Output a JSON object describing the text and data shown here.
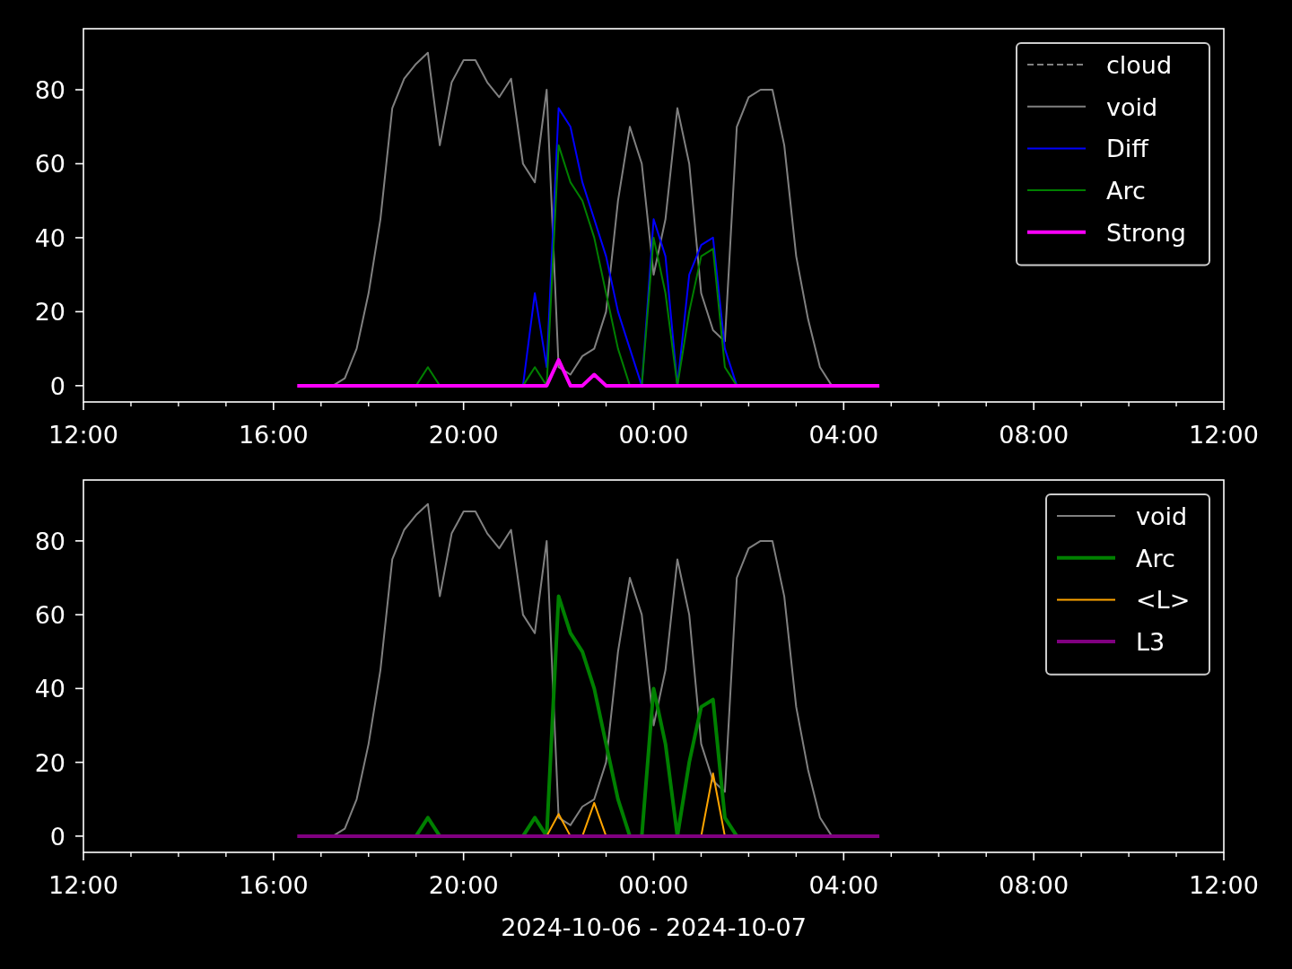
{
  "charts": [
    {
      "chart_data": {
        "type": "line",
        "categories": [
          "12:00",
          null,
          null,
          null,
          null,
          null,
          null,
          null,
          null,
          null,
          null,
          null,
          null,
          null,
          null,
          null,
          "16:00",
          null,
          null,
          null,
          null,
          null,
          null,
          null,
          null,
          null,
          null,
          null,
          null,
          null,
          null,
          null,
          "20:00",
          null,
          null,
          null,
          null,
          null,
          null,
          null,
          null,
          null,
          null,
          null,
          null,
          null,
          null,
          null,
          "00:00",
          null,
          null,
          null,
          null,
          null,
          null,
          null,
          null,
          null,
          null,
          null,
          null,
          null,
          null,
          null,
          "04:00",
          null,
          null,
          null,
          null,
          null,
          null,
          null,
          null,
          null,
          null,
          null,
          null,
          null,
          null,
          null,
          "08:00",
          null,
          null,
          null,
          null,
          null,
          null,
          null,
          null,
          null,
          null,
          null,
          null,
          null,
          null,
          null,
          "12:00"
        ],
        "ylim": [
          -4.4,
          96.5
        ],
        "yticks": [
          0,
          20,
          40,
          60,
          80
        ],
        "legend": true,
        "series": [
          {
            "name": "cloud",
            "color": "#808080",
            "line_style": "dashed",
            "values": [
              null,
              null,
              null,
              null,
              null,
              null,
              null,
              null,
              null,
              null,
              null,
              null,
              null,
              null,
              null,
              null,
              null,
              null,
              null,
              null,
              null,
              null,
              null,
              null,
              null,
              null,
              null,
              null,
              null,
              null,
              null,
              null,
              null,
              null,
              null,
              null,
              null,
              null,
              null,
              null,
              null,
              null,
              null,
              null,
              null,
              null,
              null,
              null,
              null,
              null,
              null,
              null,
              null,
              null,
              null,
              null,
              null,
              null,
              null,
              null,
              null,
              null,
              null,
              null,
              null,
              null,
              null,
              null,
              null,
              null,
              null,
              null,
              null,
              null,
              null,
              null,
              null,
              null,
              null,
              null,
              null,
              null,
              null,
              null,
              null,
              null,
              null,
              null,
              null,
              null,
              null,
              null,
              null,
              null,
              null,
              null,
              null
            ]
          },
          {
            "name": "void",
            "color": "#808080",
            "line_style": "solid",
            "values": [
              null,
              null,
              null,
              null,
              null,
              null,
              null,
              null,
              null,
              null,
              null,
              null,
              null,
              null,
              null,
              null,
              null,
              null,
              null,
              null,
              null,
              0,
              2,
              10,
              25,
              45,
              75,
              83,
              87,
              90,
              65,
              82,
              88,
              88,
              82,
              78,
              83,
              60,
              55,
              80,
              5,
              3,
              8,
              10,
              20,
              50,
              70,
              60,
              30,
              45,
              75,
              60,
              25,
              15,
              12,
              70,
              78,
              80,
              80,
              65,
              35,
              18,
              5,
              0,
              null,
              null,
              null,
              null,
              null,
              null,
              null,
              null,
              null,
              null,
              null,
              null,
              null,
              null,
              null,
              null,
              null,
              null,
              null,
              null,
              null,
              null,
              null,
              null,
              null,
              null,
              null,
              null,
              null,
              null,
              null,
              null,
              null
            ]
          },
          {
            "name": "Diff",
            "color": "#0000ff",
            "line_style": "solid",
            "values": [
              null,
              null,
              null,
              null,
              null,
              null,
              null,
              null,
              null,
              null,
              null,
              null,
              null,
              null,
              null,
              null,
              null,
              null,
              null,
              null,
              null,
              null,
              null,
              null,
              null,
              null,
              null,
              null,
              null,
              null,
              null,
              null,
              null,
              null,
              null,
              null,
              null,
              0,
              25,
              5,
              75,
              70,
              55,
              45,
              35,
              20,
              10,
              0,
              45,
              35,
              0,
              30,
              38,
              40,
              10,
              0,
              null,
              null,
              null,
              null,
              null,
              null,
              null,
              null,
              null,
              null,
              null,
              null,
              null,
              null,
              null,
              null,
              null,
              null,
              null,
              null,
              null,
              null,
              null,
              null,
              null,
              null,
              null,
              null,
              null,
              null,
              null,
              null,
              null,
              null,
              null,
              null,
              null,
              null,
              null,
              null,
              null
            ]
          },
          {
            "name": "Arc",
            "color": "#008000",
            "line_style": "solid",
            "values": [
              null,
              null,
              null,
              null,
              null,
              null,
              null,
              null,
              null,
              null,
              null,
              null,
              null,
              null,
              null,
              null,
              null,
              null,
              null,
              null,
              null,
              null,
              null,
              null,
              null,
              null,
              null,
              null,
              0,
              5,
              0,
              null,
              null,
              null,
              null,
              null,
              null,
              0,
              5,
              0,
              65,
              55,
              50,
              40,
              25,
              10,
              0,
              0,
              40,
              25,
              0,
              20,
              35,
              37,
              5,
              0,
              null,
              null,
              null,
              null,
              null,
              null,
              null,
              null,
              null,
              null,
              null,
              null,
              null,
              null,
              null,
              null,
              null,
              null,
              null,
              null,
              null,
              null,
              null,
              null,
              null,
              null,
              null,
              null,
              null,
              null,
              null,
              null,
              null,
              null,
              null,
              null,
              null,
              null,
              null,
              null,
              null
            ]
          },
          {
            "name": "Strong",
            "color": "#ff00ff",
            "line_style": "solid",
            "values": [
              null,
              null,
              null,
              null,
              null,
              null,
              null,
              null,
              null,
              null,
              null,
              null,
              null,
              null,
              null,
              null,
              null,
              null,
              0,
              0,
              0,
              0,
              0,
              0,
              0,
              0,
              0,
              0,
              0,
              0,
              0,
              0,
              0,
              0,
              0,
              0,
              0,
              0,
              0,
              0,
              7,
              0,
              0,
              3,
              0,
              0,
              0,
              0,
              0,
              0,
              0,
              0,
              0,
              0,
              0,
              0,
              0,
              0,
              0,
              0,
              0,
              0,
              0,
              0,
              0,
              0,
              0,
              0,
              null,
              null,
              null,
              null,
              null,
              null,
              null,
              null,
              null,
              null,
              null,
              null,
              null,
              null,
              null,
              null,
              null,
              null,
              null,
              null,
              null,
              null,
              null,
              null,
              null,
              null,
              null,
              null,
              null
            ]
          }
        ]
      }
    },
    {
      "chart_data": {
        "type": "line",
        "xlabel": "2024-10-06 - 2024-10-07",
        "categories": [
          "12:00",
          null,
          null,
          null,
          null,
          null,
          null,
          null,
          null,
          null,
          null,
          null,
          null,
          null,
          null,
          null,
          "16:00",
          null,
          null,
          null,
          null,
          null,
          null,
          null,
          null,
          null,
          null,
          null,
          null,
          null,
          null,
          null,
          "20:00",
          null,
          null,
          null,
          null,
          null,
          null,
          null,
          null,
          null,
          null,
          null,
          null,
          null,
          null,
          null,
          "00:00",
          null,
          null,
          null,
          null,
          null,
          null,
          null,
          null,
          null,
          null,
          null,
          null,
          null,
          null,
          null,
          "04:00",
          null,
          null,
          null,
          null,
          null,
          null,
          null,
          null,
          null,
          null,
          null,
          null,
          null,
          null,
          null,
          "08:00",
          null,
          null,
          null,
          null,
          null,
          null,
          null,
          null,
          null,
          null,
          null,
          null,
          null,
          null,
          null,
          "12:00"
        ],
        "ylim": [
          -4.4,
          96.5
        ],
        "yticks": [
          0,
          20,
          40,
          60,
          80
        ],
        "legend": true,
        "series": [
          {
            "name": "void",
            "color": "#808080",
            "line_style": "solid",
            "values": [
              null,
              null,
              null,
              null,
              null,
              null,
              null,
              null,
              null,
              null,
              null,
              null,
              null,
              null,
              null,
              null,
              null,
              null,
              null,
              null,
              null,
              0,
              2,
              10,
              25,
              45,
              75,
              83,
              87,
              90,
              65,
              82,
              88,
              88,
              82,
              78,
              83,
              60,
              55,
              80,
              5,
              3,
              8,
              10,
              20,
              50,
              70,
              60,
              30,
              45,
              75,
              60,
              25,
              15,
              12,
              70,
              78,
              80,
              80,
              65,
              35,
              18,
              5,
              0,
              null,
              null,
              null,
              null,
              null,
              null,
              null,
              null,
              null,
              null,
              null,
              null,
              null,
              null,
              null,
              null,
              null,
              null,
              null,
              null,
              null,
              null,
              null,
              null,
              null,
              null,
              null,
              null,
              null,
              null,
              null,
              null,
              null
            ]
          },
          {
            "name": "Arc",
            "color": "#008000",
            "line_style": "solid",
            "values": [
              null,
              null,
              null,
              null,
              null,
              null,
              null,
              null,
              null,
              null,
              null,
              null,
              null,
              null,
              null,
              null,
              null,
              null,
              null,
              null,
              null,
              null,
              null,
              null,
              null,
              null,
              null,
              null,
              0,
              5,
              0,
              null,
              null,
              null,
              null,
              null,
              null,
              0,
              5,
              0,
              65,
              55,
              50,
              40,
              25,
              10,
              0,
              0,
              40,
              25,
              0,
              20,
              35,
              37,
              5,
              0,
              null,
              null,
              null,
              null,
              null,
              null,
              null,
              null,
              null,
              null,
              null,
              null,
              null,
              null,
              null,
              null,
              null,
              null,
              null,
              null,
              null,
              null,
              null,
              null,
              null,
              null,
              null,
              null,
              null,
              null,
              null,
              null,
              null,
              null,
              null,
              null,
              null,
              null,
              null,
              null,
              null
            ]
          },
          {
            "name": "<L>",
            "color": "#ffa500",
            "line_style": "solid",
            "values": [
              null,
              null,
              null,
              null,
              null,
              null,
              null,
              null,
              null,
              null,
              null,
              null,
              null,
              null,
              null,
              null,
              null,
              null,
              null,
              null,
              null,
              null,
              null,
              null,
              null,
              null,
              null,
              null,
              null,
              null,
              null,
              null,
              null,
              null,
              null,
              null,
              null,
              null,
              null,
              0,
              6,
              0,
              0,
              9,
              0,
              null,
              null,
              null,
              null,
              null,
              null,
              null,
              0,
              17,
              0,
              null,
              null,
              null,
              null,
              null,
              null,
              null,
              null,
              null,
              null,
              null,
              null,
              null,
              null,
              null,
              null,
              null,
              null,
              null,
              null,
              null,
              null,
              null,
              null,
              null,
              null,
              null,
              null,
              null,
              null,
              null,
              null,
              null,
              null,
              null,
              null,
              null,
              null,
              null,
              null,
              null,
              null
            ]
          },
          {
            "name": "L3",
            "color": "#800080",
            "line_style": "solid",
            "values": [
              null,
              null,
              null,
              null,
              null,
              null,
              null,
              null,
              null,
              null,
              null,
              null,
              null,
              null,
              null,
              null,
              null,
              null,
              0,
              0,
              0,
              0,
              0,
              0,
              0,
              0,
              0,
              0,
              0,
              0,
              0,
              0,
              0,
              0,
              0,
              0,
              0,
              0,
              0,
              0,
              0,
              0,
              0,
              0,
              0,
              0,
              0,
              0,
              0,
              0,
              0,
              0,
              0,
              0,
              0,
              0,
              0,
              0,
              0,
              0,
              0,
              0,
              0,
              0,
              0,
              0,
              0,
              0,
              null,
              null,
              null,
              null,
              null,
              null,
              null,
              null,
              null,
              null,
              null,
              null,
              null,
              null,
              null,
              null,
              null,
              null,
              null,
              null,
              null,
              null,
              null,
              null,
              null,
              null,
              null,
              null,
              null
            ]
          }
        ]
      }
    }
  ]
}
